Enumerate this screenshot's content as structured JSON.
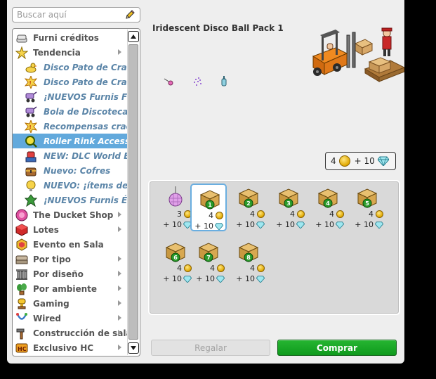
{
  "search": {
    "placeholder": "Buscar aquí"
  },
  "nav": {
    "items": [
      {
        "label": "Furni créditos",
        "sub": false,
        "arrow": false,
        "icon": "credit-stack-icon"
      },
      {
        "label": "Tendencia",
        "sub": false,
        "arrow": true,
        "icon": "star-icon"
      },
      {
        "label": "Disco Pato de Crafteo",
        "sub": true,
        "arrow": false,
        "icon": "duck-icon"
      },
      {
        "label": "Disco Pato de Crafteo",
        "sub": true,
        "arrow": false,
        "icon": "star-burst-icon"
      },
      {
        "label": "¡NUEVOS Furnis Fiesta",
        "sub": true,
        "arrow": false,
        "icon": "stroller-icon"
      },
      {
        "label": "Bola de Discoteca Iridiscente",
        "sub": true,
        "arrow": false,
        "icon": "stroller-icon"
      },
      {
        "label": "Recompensas craqueables",
        "sub": true,
        "arrow": false,
        "icon": "star-burst-icon"
      },
      {
        "label": "Roller Rink Accessories",
        "sub": true,
        "arrow": false,
        "icon": "magnifier-icon",
        "active": true
      },
      {
        "label": "NEW: DLC World Bag",
        "sub": true,
        "arrow": false,
        "icon": "robot-icon"
      },
      {
        "label": "Nuevo: Cofres",
        "sub": true,
        "arrow": false,
        "icon": "chest-icon"
      },
      {
        "label": "NUEVO: ¡ítems de Mo",
        "sub": true,
        "arrow": false,
        "icon": "lightbulb-icon"
      },
      {
        "label": "¡NUEVOS Furnis Élficos",
        "sub": true,
        "arrow": false,
        "icon": "leaf-icon"
      },
      {
        "label": "The Ducket Shop",
        "sub": false,
        "arrow": true,
        "icon": "ducket-icon"
      },
      {
        "label": "Lotes",
        "sub": false,
        "arrow": true,
        "icon": "cube-icon"
      },
      {
        "label": "Evento en Sala",
        "sub": false,
        "arrow": false,
        "icon": "hexagon-icon"
      },
      {
        "label": "Por tipo",
        "sub": false,
        "arrow": true,
        "icon": "sofa-icon"
      },
      {
        "label": "Por diseño",
        "sub": false,
        "arrow": true,
        "icon": "columns-icon"
      },
      {
        "label": "Por ambiente",
        "sub": false,
        "arrow": true,
        "icon": "plant-icon"
      },
      {
        "label": "Gaming",
        "sub": false,
        "arrow": true,
        "icon": "trophy-icon"
      },
      {
        "label": "Wired",
        "sub": false,
        "arrow": true,
        "icon": "wired-icon"
      },
      {
        "label": "Construcción de salas",
        "sub": false,
        "arrow": true,
        "icon": "hammer-icon"
      },
      {
        "label": "Exclusivo HC",
        "sub": false,
        "arrow": true,
        "icon": "hc-icon"
      }
    ]
  },
  "product": {
    "title": "Iridescent Disco Ball Pack 1",
    "price_credits": "4",
    "price_diamonds": "+ 10"
  },
  "offers": [
    {
      "credits": "3",
      "diamonds": "+ 10",
      "kind": "disco",
      "num": ""
    },
    {
      "credits": "4",
      "diamonds": "+ 10",
      "kind": "box",
      "num": "1",
      "selected": true
    },
    {
      "credits": "4",
      "diamonds": "+ 10",
      "kind": "box",
      "num": "2"
    },
    {
      "credits": "4",
      "diamonds": "+ 10",
      "kind": "box",
      "num": "3"
    },
    {
      "credits": "4",
      "diamonds": "+ 10",
      "kind": "box",
      "num": "4"
    },
    {
      "credits": "4",
      "diamonds": "+ 10",
      "kind": "box",
      "num": "5"
    },
    {
      "credits": "4",
      "diamonds": "+ 10",
      "kind": "box",
      "num": "6"
    },
    {
      "credits": "4",
      "diamonds": "+ 10",
      "kind": "box",
      "num": "7"
    },
    {
      "credits": "4",
      "diamonds": "+ 10",
      "kind": "box",
      "num": "8"
    }
  ],
  "buttons": {
    "gift": "Regalar",
    "buy": "Comprar"
  },
  "colors": {
    "active_item": "#62a9dc",
    "sub_item_text": "#5b85a8",
    "buy_button": "#16a524"
  }
}
